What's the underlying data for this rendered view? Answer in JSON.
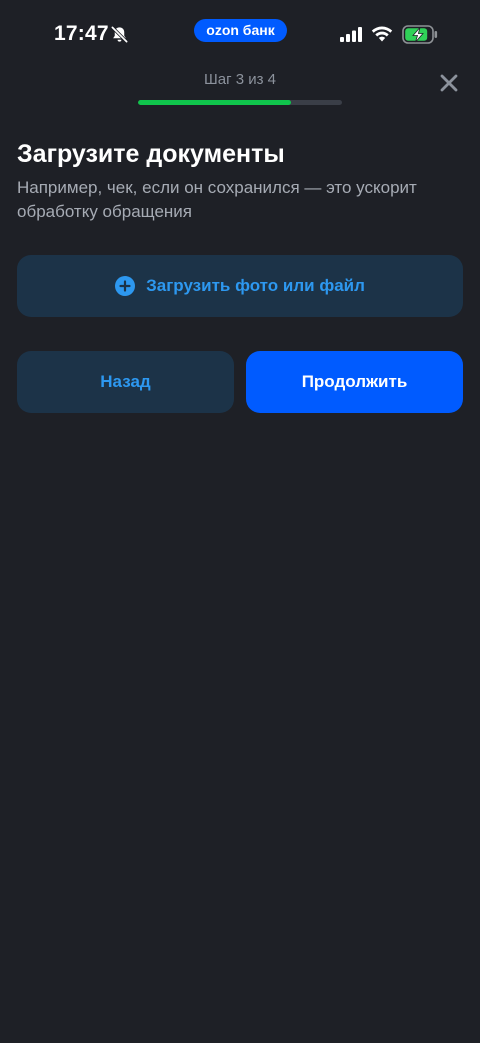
{
  "status_bar": {
    "time": "17:47",
    "brand": "ozon банк",
    "icons": [
      "bell-off-icon",
      "signal-icon",
      "wifi-icon",
      "battery-charging-icon"
    ]
  },
  "header": {
    "step_label": "Шаг 3 из 4",
    "progress": 0.75,
    "close_icon": "close-icon"
  },
  "main": {
    "title": "Загрузите документы",
    "subtitle": "Например, чек, если он сохранился — это ускорит обработку обращения",
    "upload_label": "Загрузить фото или файл",
    "upload_icon": "plus-circle-icon"
  },
  "actions": {
    "back_label": "Назад",
    "continue_label": "Продолжить"
  },
  "colors": {
    "background": "#1e2026",
    "accent": "#005bff",
    "secondary_button": "#1c3348",
    "secondary_text": "#2d98f0",
    "progress": "#10c44c"
  }
}
